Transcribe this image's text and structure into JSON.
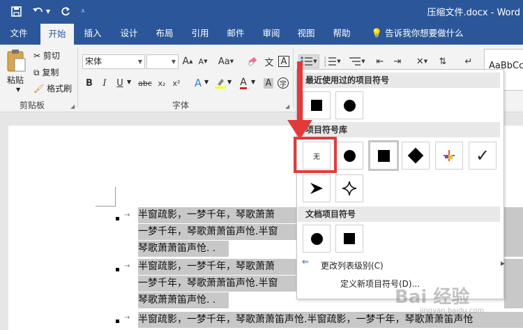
{
  "window": {
    "title": "压缩文件.docx  -  Word"
  },
  "tabs": [
    {
      "label": "文件"
    },
    {
      "label": "开始"
    },
    {
      "label": "插入"
    },
    {
      "label": "设计"
    },
    {
      "label": "布局"
    },
    {
      "label": "引用"
    },
    {
      "label": "邮件"
    },
    {
      "label": "审阅"
    },
    {
      "label": "视图"
    },
    {
      "label": "帮助"
    }
  ],
  "tellme": "告诉我你想要做什么",
  "clipboard": {
    "paste": "粘贴",
    "cut": "剪切",
    "copy": "复制",
    "format_painter": "格式刷",
    "label": "剪贴板"
  },
  "font": {
    "name": "宋体",
    "size": "",
    "label": "字体",
    "aa": "Aa",
    "bold": "B",
    "italic": "I",
    "underline": "U",
    "strike": "abc",
    "sub": "x₂",
    "sup": "x²",
    "grow": "A",
    "shrink": "A"
  },
  "styles_preview": "AaBbCcI",
  "gallery": {
    "recent_header": "最近使用过的项目符号",
    "library_header": "项目符号库",
    "doc_header": "文档项目符号",
    "none_label": "无",
    "change_level": "更改列表级别(C)",
    "define_new": "定义新项目符号(D)..."
  },
  "document": {
    "lines": [
      "半窗疏影，一梦千年，琴歌萧萧",
      "一梦千年，琴歌萧萧笛声怆.半窗",
      "琴歌萧萧笛声怆. .",
      "半窗疏影，一梦千年，琴歌萧萧",
      "一梦千年，琴歌萧萧笛声怆.半窗",
      "琴歌萧萧笛声怆. .",
      "半窗疏影，一梦千年，琴歌萧萧笛声怆.半窗疏影，一梦千年，琴歌萧萧笛声怆"
    ]
  },
  "watermark": "Bai 经验",
  "watermark_sub": "jingyan.baidu.com"
}
